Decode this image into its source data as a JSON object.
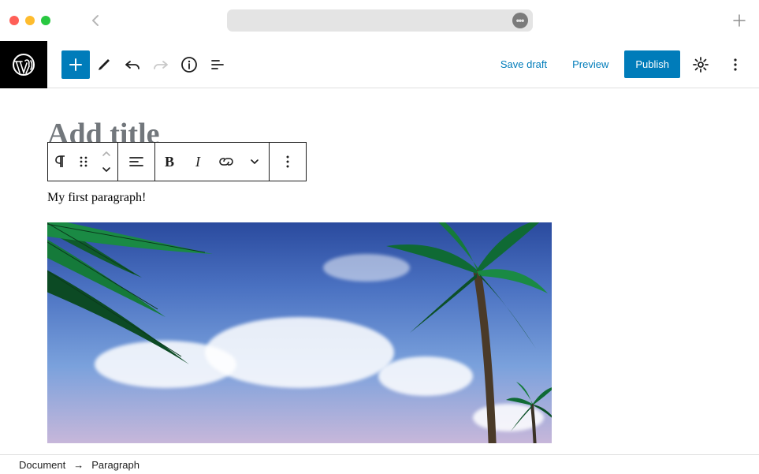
{
  "toolbar": {
    "save_draft": "Save draft",
    "preview": "Preview",
    "publish": "Publish"
  },
  "editor": {
    "title_placeholder": "Add title",
    "paragraph": "My first paragraph!"
  },
  "breadcrumb": {
    "root": "Document",
    "current": "Paragraph"
  },
  "icons": {
    "add": "add-icon",
    "edit": "pencil-icon",
    "undo": "undo-icon",
    "redo": "redo-icon",
    "info": "info-icon",
    "outline": "outline-icon",
    "settings": "gear-icon",
    "more": "kebab-icon",
    "back": "chevron-left-icon",
    "new_tab": "plus-icon",
    "paragraph": "paragraph-icon",
    "drag": "drag-handle-icon",
    "move_up": "chevron-up-icon",
    "move_down": "chevron-down-icon",
    "align": "align-left-icon",
    "bold": "B",
    "italic": "I",
    "link": "link-icon",
    "dropdown": "chevron-down-icon",
    "block_more": "kebab-icon",
    "addr_badge": "•••"
  }
}
